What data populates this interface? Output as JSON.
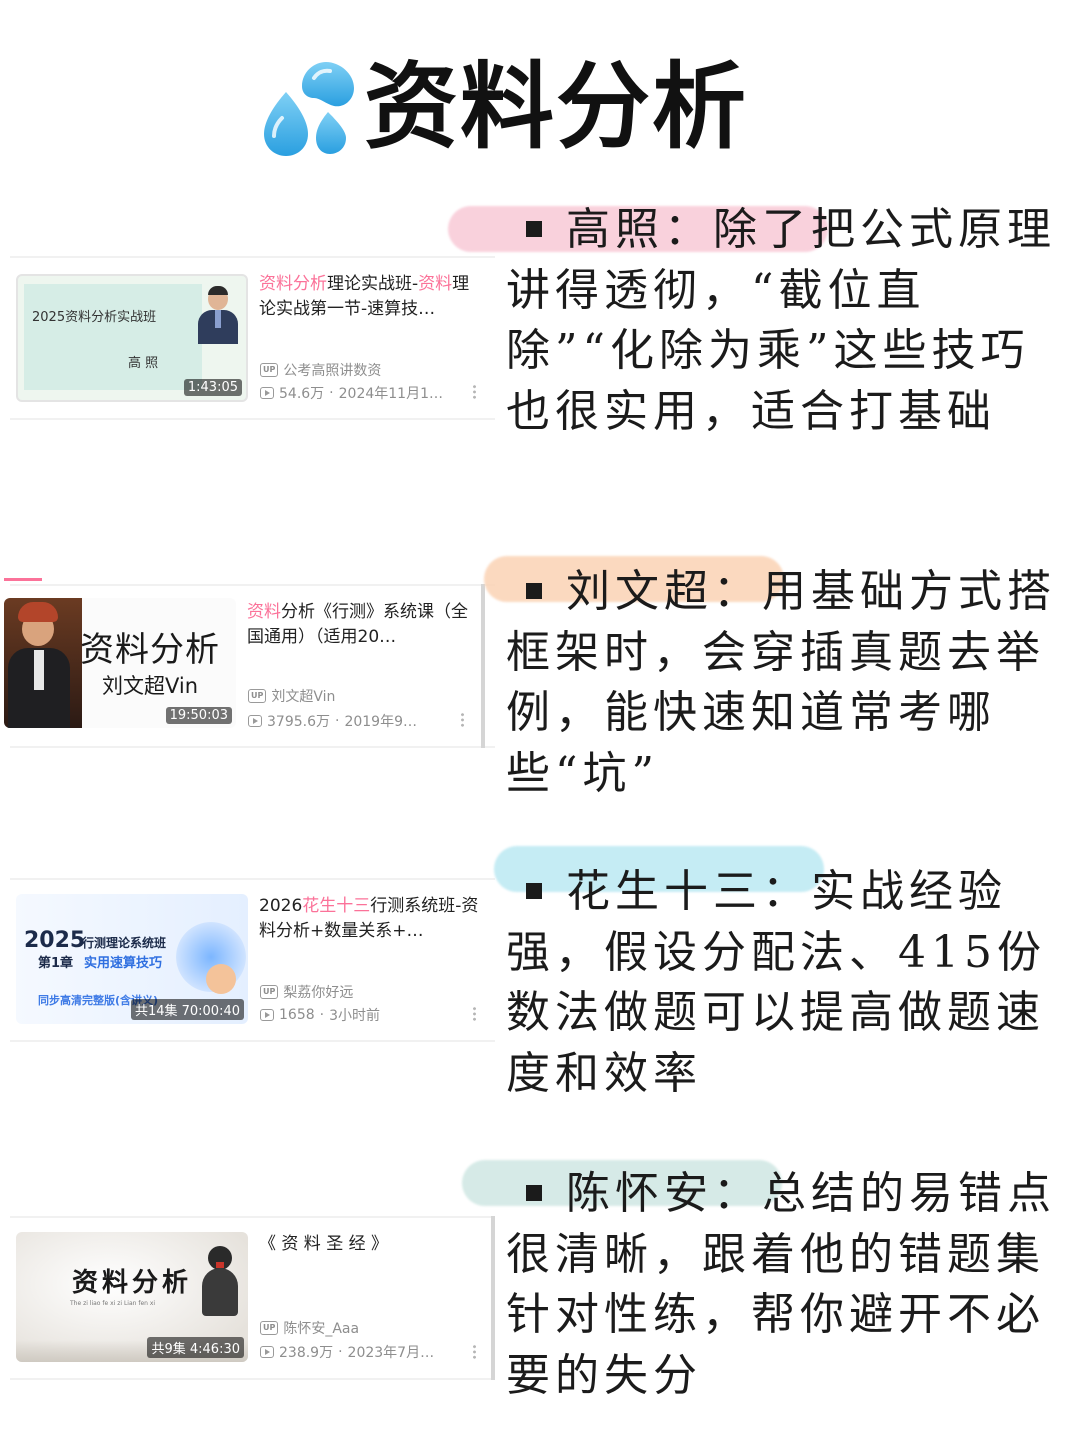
{
  "header": {
    "title": "资料分析",
    "icon": "water-drops-icon",
    "icon_color": "#4fb3e8"
  },
  "cards": [
    {
      "thumb_title": "2025资料分析实战班",
      "thumb_subtitle": "高 照",
      "duration": "1:43:05",
      "title_hl1": "资料分析",
      "title_mid": "理论实战班-",
      "title_hl2": "资料",
      "title_rest": "理论实战第一节-速算技…",
      "uploader": "公考高照讲数资",
      "views": "54.6万",
      "date": "2024年11月1…"
    },
    {
      "thumb_title": "资料分析",
      "thumb_subtitle": "刘文超Vin",
      "duration": "19:50:03",
      "title_hl1": "资料",
      "title_rest": "分析《行测》系统课（全国通用）（适用20…",
      "uploader": "刘文超Vin",
      "views": "3795.6万",
      "date": "2019年9…"
    },
    {
      "thumb_year": "2025",
      "thumb_course": "行测理论系统班",
      "thumb_chapter": "第1章",
      "thumb_topic": "实用速算技巧",
      "thumb_note": "同步高清完整版(含讲义)",
      "duration": "共14集 70:00:40",
      "title_pre": "2026",
      "title_hl1": "花生十三",
      "title_rest": "行测系统班-资料分析+数量关系+…",
      "uploader": "梨荔你好远",
      "views": "1658",
      "date": "3小时前"
    },
    {
      "thumb_title": "资料分析",
      "thumb_caption": "The zi liao fe xi zi Lian fen xi",
      "duration": "共9集 4:46:30",
      "title_rest": "《 资 料 圣 经 》",
      "uploader": "陈怀安_Aaa",
      "views": "238.9万",
      "date": "2023年7月…"
    }
  ],
  "reviews": [
    {
      "text": "高照：除了把公式原理讲得透彻，“截位直除”“化除为乘”这些技巧也很实用，适合打基础",
      "marker_color": "#f8c6d4"
    },
    {
      "text": "刘文超：用基础方式搭框架时，会穿插真题去举例，能快速知道常考哪些“坑”",
      "marker_color": "#fbd3b5"
    },
    {
      "text": "花生十三：实战经验强，假设分配法、415份数法做题可以提高做题速度和效率",
      "marker_color": "#bfeaf3"
    },
    {
      "text": "陈怀安：总结的易错点很清晰，跟着他的错题集针对性练，帮你避开不必要的失分",
      "marker_color": "#cfe7e3"
    }
  ]
}
